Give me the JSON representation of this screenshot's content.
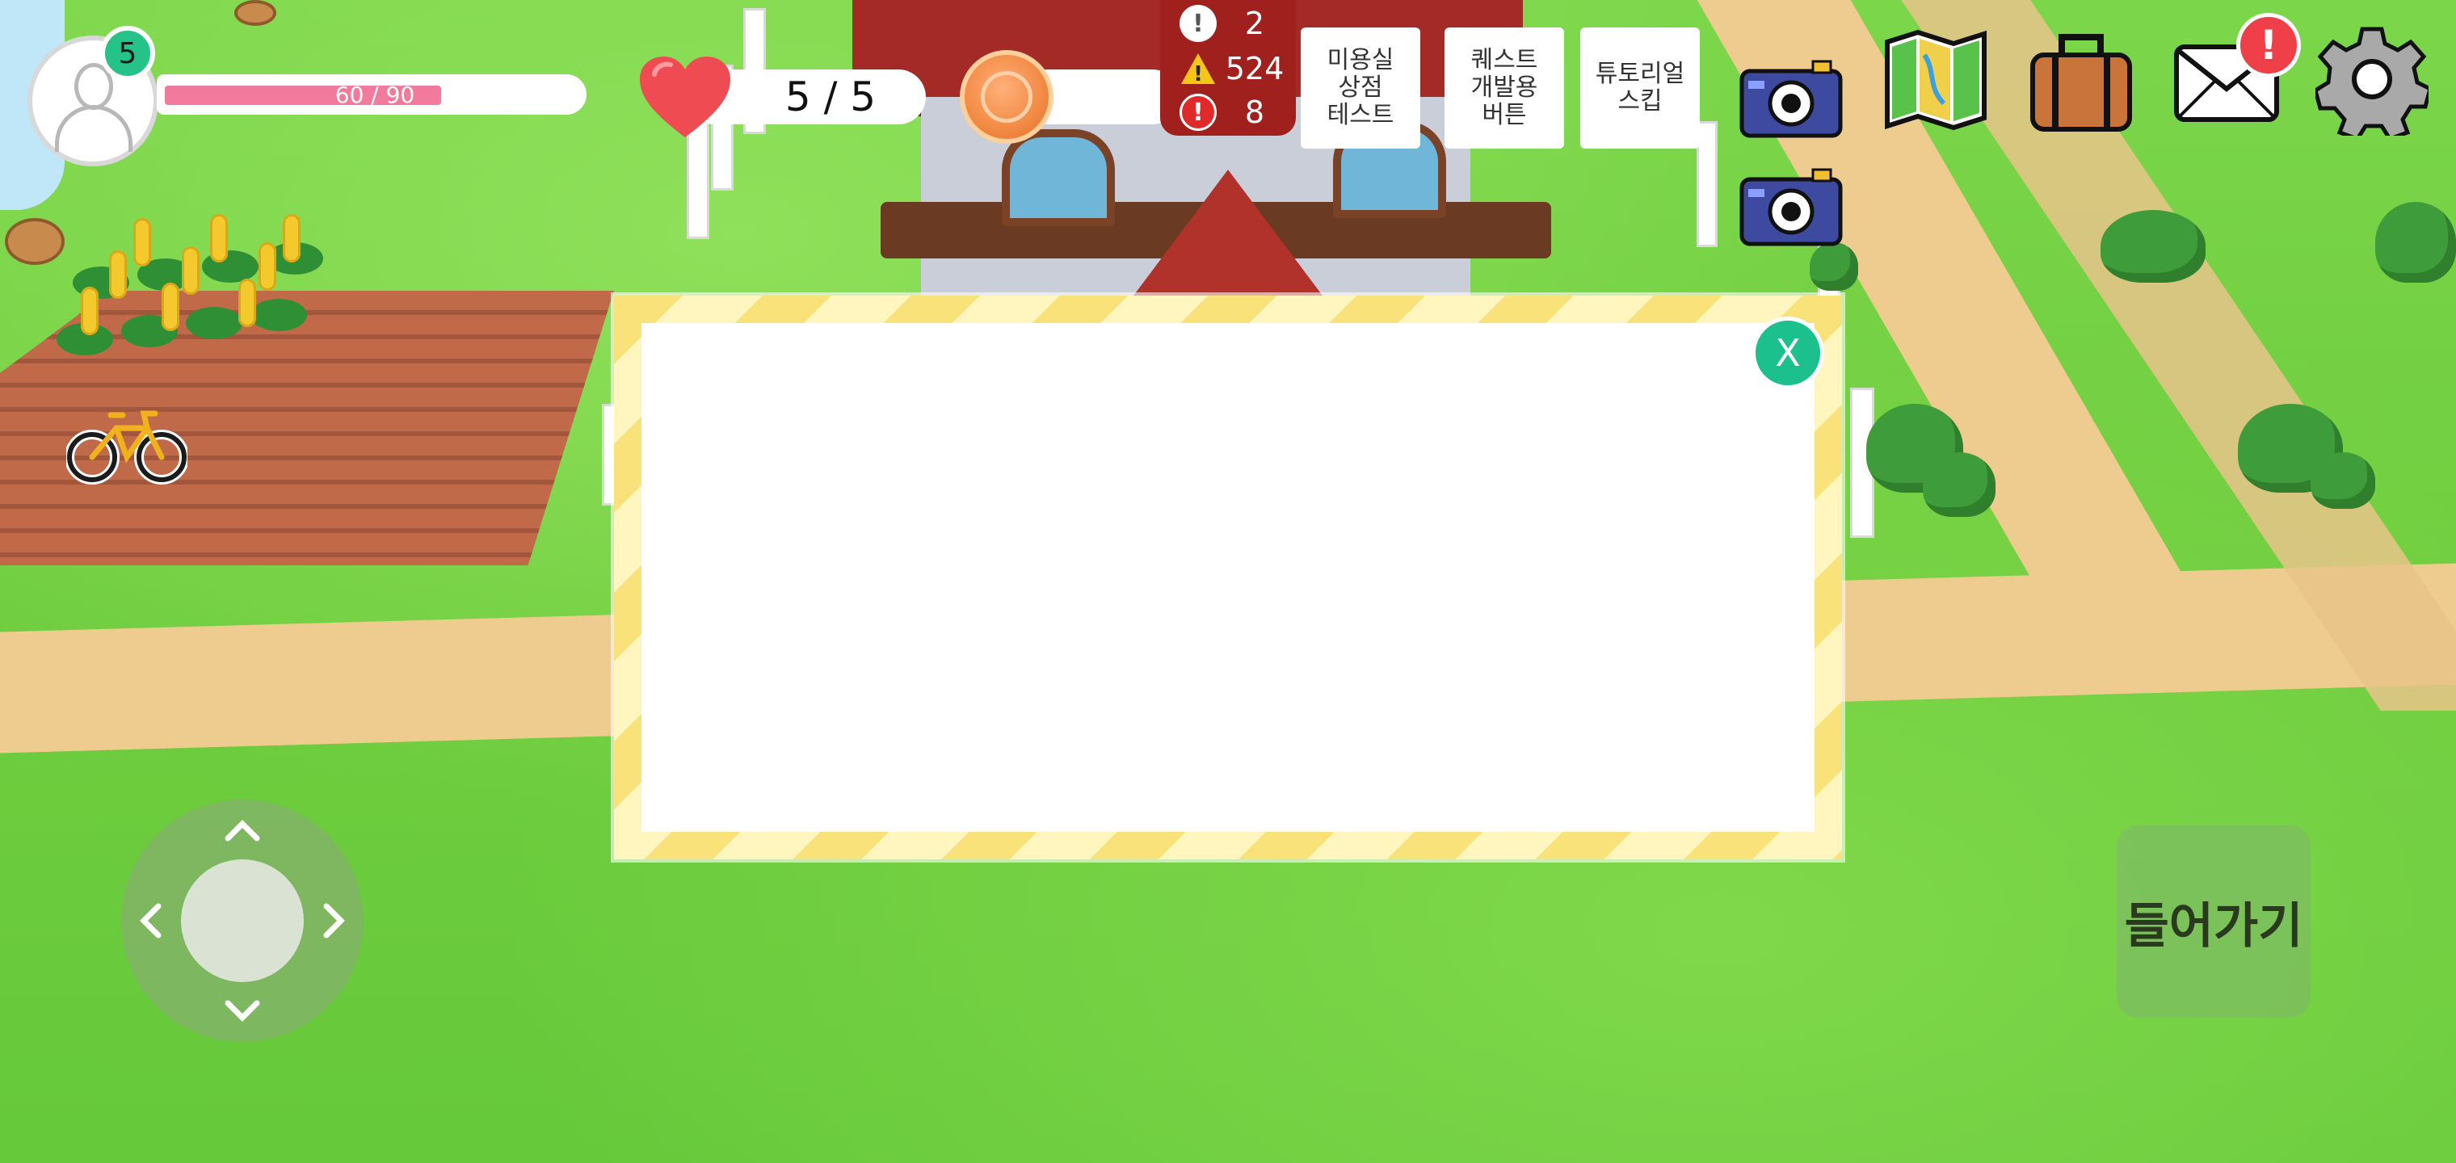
{
  "player": {
    "level": "5",
    "hp_text": "60 / 90",
    "hp_fraction": 0.667
  },
  "hearts": {
    "text": "5 / 5"
  },
  "coins": {
    "text": ""
  },
  "alerts": [
    {
      "icon": "info-icon",
      "value": "2"
    },
    {
      "icon": "warning-icon",
      "value": "524"
    },
    {
      "icon": "error-icon",
      "value": "8"
    }
  ],
  "dev_buttons": [
    {
      "label": "미용실\n상점\n테스트"
    },
    {
      "label": "퀘스트\n개발용\n버튼"
    },
    {
      "label": "튜토리얼\n스킵"
    }
  ],
  "top_icons": [
    "map-icon",
    "bag-icon",
    "mail-icon",
    "gear-icon"
  ],
  "mail_badge": "!",
  "dialog": {
    "close_label": "X"
  },
  "joystick": {
    "up": "^",
    "down": "v",
    "left": "<",
    "right": ">"
  },
  "enter_button": "들어가기",
  "colors": {
    "hp_fill": "#f27a9c",
    "level_badge": "#25c28a",
    "alert_panel": "#a0201e",
    "dialog_close": "#1cc08c",
    "notify_badge": "#ef3f48"
  }
}
